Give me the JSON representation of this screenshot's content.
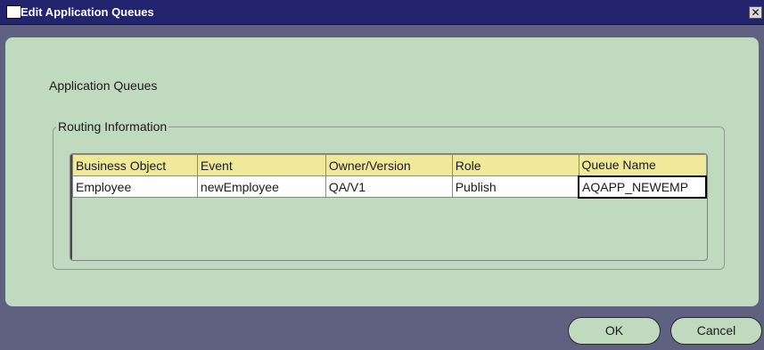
{
  "window": {
    "title": "Edit Application Queues",
    "close_glyph": "✕"
  },
  "panel": {
    "heading": "Application Queues",
    "group_title": "Routing Information"
  },
  "table": {
    "columns": [
      "Business Object",
      "Event",
      "Owner/Version",
      "Role",
      "Queue Name"
    ],
    "rows": [
      [
        "Employee",
        "newEmployee",
        "QA/V1",
        "Publish",
        "AQAPP_NEWEMP"
      ]
    ]
  },
  "buttons": {
    "ok": "OK",
    "cancel": "Cancel"
  },
  "colors": {
    "titlebar": "#23236e",
    "panel": "#bfdabe",
    "header": "#f1e99a",
    "background": "#5e6280"
  },
  "icons": {
    "title_icon": "application-icon",
    "close_icon": "close-icon"
  }
}
